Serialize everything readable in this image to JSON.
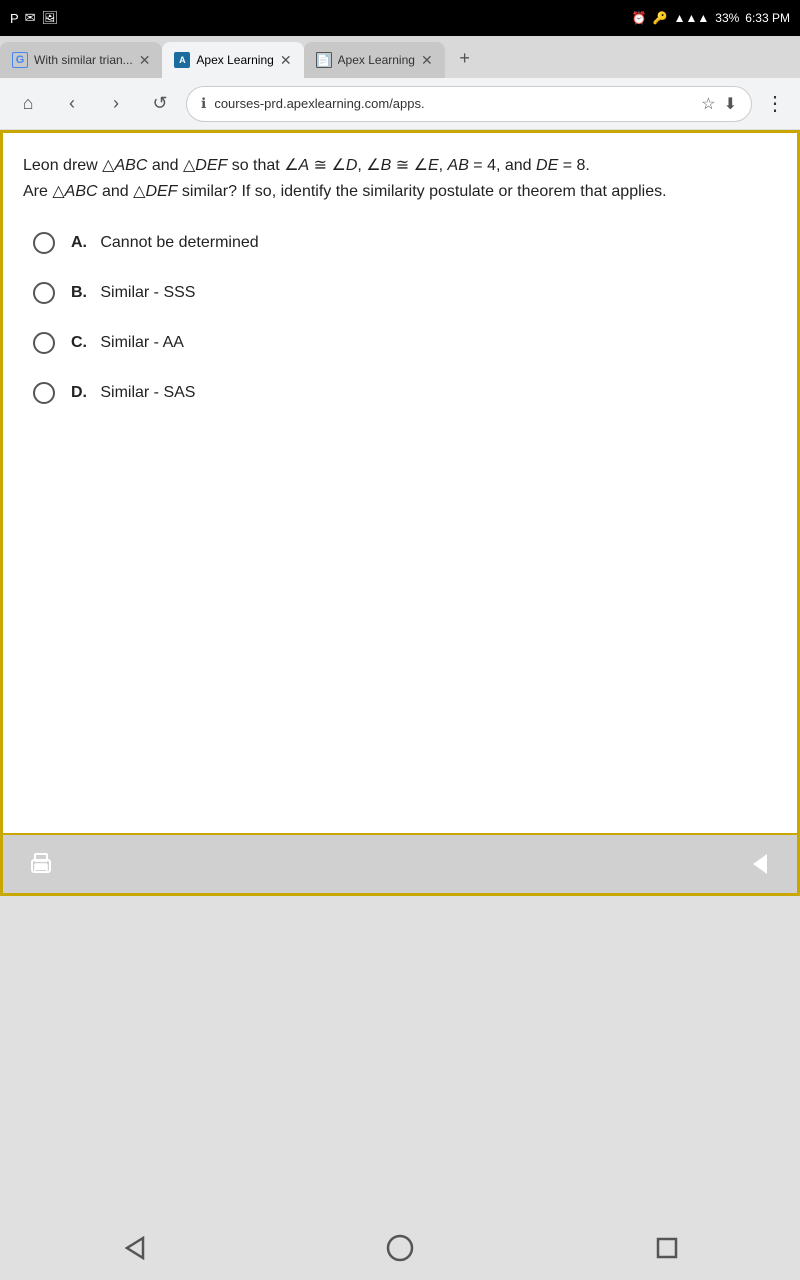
{
  "statusBar": {
    "time": "6:33 PM",
    "battery": "33%",
    "signal": "●●●",
    "icons": [
      "pocket-icon",
      "mail-icon",
      "image-icon"
    ]
  },
  "browser": {
    "tabs": [
      {
        "id": "tab-google",
        "label": "With similar trian...",
        "icon": "google-icon",
        "active": false
      },
      {
        "id": "tab-apex1",
        "label": "Apex Learning",
        "icon": "apex-icon",
        "active": true
      },
      {
        "id": "tab-apex2",
        "label": "Apex Learning",
        "icon": "file-icon",
        "active": false
      }
    ],
    "addressBar": {
      "url": "courses-prd.apexlearning.com/apps.",
      "placeholder": "courses-prd.apexlearning.com/apps."
    }
  },
  "question": {
    "text_part1": "Leon drew △ABC and △DEF so that ∠A ≅ ∠D, ∠B ≅ ∠E, AB = 4, and DE = 8.",
    "text_part2": "Are △ABC and △DEF similar? If so, identify the similarity postulate or theorem that applies.",
    "options": [
      {
        "id": "A",
        "letter": "A.",
        "text": "Cannot be determined"
      },
      {
        "id": "B",
        "letter": "B.",
        "text": "Similar - SSS"
      },
      {
        "id": "C",
        "letter": "C.",
        "text": "Similar - AA"
      },
      {
        "id": "D",
        "letter": "D.",
        "text": "Similar - SAS"
      }
    ]
  },
  "toolbar": {
    "print_label": "🖨",
    "arrow_label": "◀"
  },
  "androidNav": {
    "back": "◁",
    "home": "○",
    "recents": "□"
  }
}
